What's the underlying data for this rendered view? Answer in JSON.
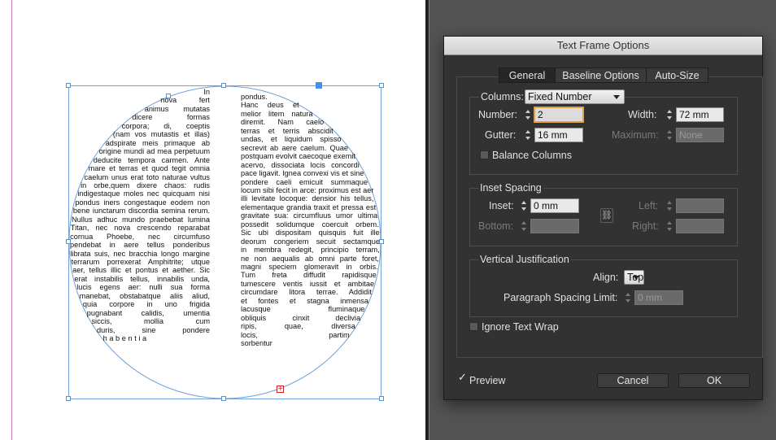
{
  "document": {
    "column1_lines": [
      "In",
      "nova fert",
      "animus mutatas",
      "dicere formas",
      "corpora; di, coeptis",
      "(nam vos mutastis et illas)",
      "adspirate meis primaque ab",
      "origine mundi ad mea perpetuum",
      "deducite tempora carmen. Ante",
      "mare et terras et quod tegit omnia",
      "caelum unus erat toto naturae vultus",
      "in orbe,quem dixere chaos: rudis",
      "indigestaque moles nec quicquam nisi",
      "pondus iners congestaque eodem non",
      "bene iunctarum discordia semina rerum.",
      "Nullus adhuc mundo praebebat lumina",
      "Titan, nec nova crescendo reparabat",
      "cornua Phoebe, nec circumfuso",
      "pendebat in aere tellus ponderibus",
      "librata suis, nec bracchia longo margine",
      "terrarum porrexerat Amphitrite; utque",
      "aer, tellus illic et pontus et aether. Sic",
      "erat instabilis tellus, innabilis unda,",
      "lucis egens aer: nulli sua forma",
      "manebat, obstabatque aliis aliud,",
      "quia corpore in uno frigida",
      "pugnabant calidis, umentia",
      "siccis, mollia cum",
      "duris, sine pondere",
      "habentia"
    ],
    "column2_lines": [
      "pondus.",
      "Hanc deus et",
      "melior litem natura",
      "diremit. Nam caelo",
      "terras et terris abscidit",
      "undas, et liquidum spisso",
      "secrevit ab aere caelum. Quae",
      "postquam evolvit caecoque exemit",
      "acervo, dissociata locis concordi",
      "pace ligavit. Ignea convexi vis et sine",
      "pondere caeli emicuit summaque",
      "locum sibi fecit in arce: proximus est aer",
      "illi levitate locoque: densior his tellus,",
      "elementaque grandia traxit et pressa est",
      "gravitate sua: circumfluus umor ultima",
      "possedit solidumque coercuit orbem.",
      "Sic ubi dispositam quisquis fuit ille",
      "deorum congeriem secuit sectamque",
      "in membra redegit, principio terram,",
      "ne non aequalis ab omni parte foret,",
      "magni speciem glomeravit in orbis.",
      "Tum freta diffudit rapidisque",
      "tumescere ventis iussit et ambitae",
      "circumdare litora terrae. Addidit",
      "et fontes et stagna inmensa",
      "lacusque fluminaque",
      "obliquis cinxit declivia",
      "ripis, quae, diversa",
      "locis, partim",
      "sorbentur"
    ],
    "overset_symbol": "+"
  },
  "dialog": {
    "title": "Text Frame Options",
    "tabs": [
      {
        "label": "General",
        "active": true
      },
      {
        "label": "Baseline Options",
        "active": false
      },
      {
        "label": "Auto-Size",
        "active": false
      }
    ],
    "columns": {
      "label": "Columns:",
      "mode_value": "Fixed Number",
      "number_label": "Number:",
      "number_value": "2",
      "width_label": "Width:",
      "width_value": "72 mm",
      "gutter_label": "Gutter:",
      "gutter_value": "16 mm",
      "maximum_label": "Maximum:",
      "maximum_value": "None",
      "balance_label": "Balance Columns",
      "balance_checked": false
    },
    "inset_spacing": {
      "title": "Inset Spacing",
      "inset_label": "Inset:",
      "inset_value": "0 mm",
      "bottom_label": "Bottom:",
      "bottom_value": "",
      "left_label": "Left:",
      "left_value": "",
      "right_label": "Right:",
      "right_value": ""
    },
    "vertical_justification": {
      "title": "Vertical Justification",
      "align_label": "Align:",
      "align_value": "Top",
      "psl_label": "Paragraph Spacing Limit:",
      "psl_value": "0 mm"
    },
    "ignore_wrap_label": "Ignore Text Wrap",
    "ignore_wrap_checked": false,
    "preview_label": "Preview",
    "preview_checked": true,
    "cancel_label": "Cancel",
    "ok_label": "OK"
  },
  "colors": {
    "frame_stroke": "#6fa0d8",
    "selection_handle": "#4a8ff0",
    "overset": "#d02020",
    "dialog_bg": "#323232"
  }
}
